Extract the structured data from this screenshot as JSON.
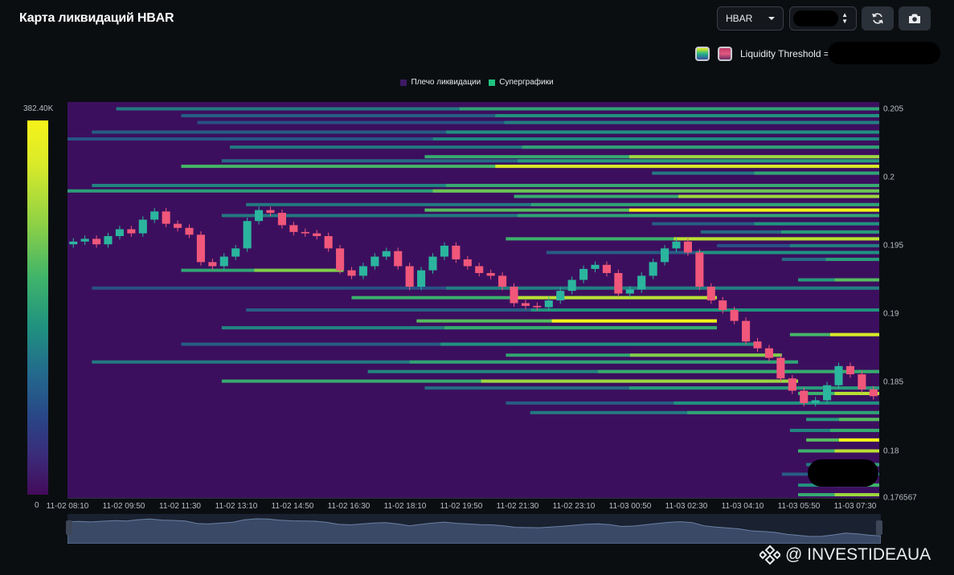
{
  "title": "Карта ликвидаций HBAR",
  "controls": {
    "symbol": "HBAR",
    "refresh_icon": "refresh-icon",
    "camera_icon": "camera-icon"
  },
  "threshold_label": "Liquidity Threshold =",
  "legend": [
    {
      "label": "Плечо ликвидации",
      "color": "#3c1a64"
    },
    {
      "label": "Суперграфики",
      "color": "#1fc27e"
    }
  ],
  "colorbar": {
    "max_label": "382.40K",
    "min_label": "0"
  },
  "watermark": "@ INVESTIDEAUA",
  "colors": {
    "background": "#0b0e11",
    "plot_bg": "#3c0f5e",
    "up": "#2bb59e",
    "down": "#f0577a"
  },
  "chart_data": {
    "type": "heatmap",
    "title": "Карта ликвидаций HBAR",
    "x_ticks": [
      "11-02 08:10",
      "11-02 09:50",
      "11-02 11:30",
      "11-02 13:10",
      "11-02 14:50",
      "11-02 16:30",
      "11-02 18:10",
      "11-02 19:50",
      "11-02 21:30",
      "11-02 23:10",
      "11-03 00:50",
      "11-03 02:30",
      "11-03 04:10",
      "11-03 05:50",
      "11-03 07:30"
    ],
    "y_ticks": [
      "0.205",
      "0.2",
      "0.195",
      "0.19",
      "0.185",
      "0.18",
      "0.176567"
    ],
    "ylim": [
      0.176567,
      0.2055
    ],
    "colorbar_range": [
      0,
      382400
    ],
    "price_series": {
      "type": "candlestick",
      "close": [
        0.1953,
        0.1955,
        0.1951,
        0.1957,
        0.1962,
        0.1959,
        0.1969,
        0.1975,
        0.1966,
        0.1963,
        0.1958,
        0.1938,
        0.1935,
        0.1942,
        0.1948,
        0.1968,
        0.1976,
        0.1974,
        0.1965,
        0.196,
        0.1959,
        0.1957,
        0.1948,
        0.1932,
        0.1928,
        0.1935,
        0.1942,
        0.1946,
        0.1935,
        0.192,
        0.1932,
        0.1942,
        0.195,
        0.194,
        0.1935,
        0.193,
        0.1928,
        0.192,
        0.1908,
        0.1906,
        0.1905,
        0.191,
        0.1917,
        0.1925,
        0.1933,
        0.1936,
        0.193,
        0.1915,
        0.1918,
        0.1928,
        0.1938,
        0.1948,
        0.1953,
        0.1945,
        0.192,
        0.191,
        0.1903,
        0.1895,
        0.188,
        0.1875,
        0.1868,
        0.1853,
        0.1844,
        0.1835,
        0.1837,
        0.1848,
        0.1862,
        0.1856,
        0.1845,
        0.184
      ]
    },
    "liquidity_levels": [
      {
        "price": 0.205,
        "start": 0.06,
        "end": 1.0,
        "intensity": 0.55
      },
      {
        "price": 0.2045,
        "start": 0.14,
        "end": 1.0,
        "intensity": 0.45
      },
      {
        "price": 0.204,
        "start": 0.16,
        "end": 1.0,
        "intensity": 0.4
      },
      {
        "price": 0.2033,
        "start": 0.03,
        "end": 1.0,
        "intensity": 0.45
      },
      {
        "price": 0.2028,
        "start": 0.0,
        "end": 1.0,
        "intensity": 0.42
      },
      {
        "price": 0.2022,
        "start": 0.2,
        "end": 1.0,
        "intensity": 0.55
      },
      {
        "price": 0.2015,
        "start": 0.44,
        "end": 1.0,
        "intensity": 0.85
      },
      {
        "price": 0.2012,
        "start": 0.19,
        "end": 1.0,
        "intensity": 0.5
      },
      {
        "price": 0.2008,
        "start": 0.14,
        "end": 1.0,
        "intensity": 0.95
      },
      {
        "price": 0.2003,
        "start": 0.72,
        "end": 1.0,
        "intensity": 0.55
      },
      {
        "price": 0.1994,
        "start": 0.03,
        "end": 1.0,
        "intensity": 0.6
      },
      {
        "price": 0.199,
        "start": 0.0,
        "end": 1.0,
        "intensity": 0.75
      },
      {
        "price": 0.1986,
        "start": 0.55,
        "end": 1.0,
        "intensity": 0.85
      },
      {
        "price": 0.198,
        "start": 0.22,
        "end": 1.0,
        "intensity": 0.55
      },
      {
        "price": 0.1976,
        "start": 0.44,
        "end": 1.0,
        "intensity": 1.0
      },
      {
        "price": 0.1972,
        "start": 0.19,
        "end": 1.0,
        "intensity": 0.55
      },
      {
        "price": 0.1966,
        "start": 0.72,
        "end": 1.0,
        "intensity": 0.45
      },
      {
        "price": 0.196,
        "start": 0.78,
        "end": 1.0,
        "intensity": 0.5
      },
      {
        "price": 0.1955,
        "start": 0.54,
        "end": 1.0,
        "intensity": 0.9
      },
      {
        "price": 0.195,
        "start": 0.8,
        "end": 1.0,
        "intensity": 0.4
      },
      {
        "price": 0.1945,
        "start": 0.59,
        "end": 1.0,
        "intensity": 0.45
      },
      {
        "price": 0.194,
        "start": 0.88,
        "end": 1.0,
        "intensity": 0.5
      },
      {
        "price": 0.1932,
        "start": 0.14,
        "end": 0.34,
        "intensity": 0.8
      },
      {
        "price": 0.1925,
        "start": 0.9,
        "end": 1.0,
        "intensity": 0.7
      },
      {
        "price": 0.1919,
        "start": 0.03,
        "end": 1.0,
        "intensity": 0.4
      },
      {
        "price": 0.1912,
        "start": 0.35,
        "end": 0.8,
        "intensity": 0.9
      },
      {
        "price": 0.1903,
        "start": 0.22,
        "end": 1.0,
        "intensity": 0.45
      },
      {
        "price": 0.1895,
        "start": 0.43,
        "end": 0.8,
        "intensity": 1.0
      },
      {
        "price": 0.189,
        "start": 0.19,
        "end": 0.8,
        "intensity": 0.6
      },
      {
        "price": 0.1885,
        "start": 0.89,
        "end": 1.0,
        "intensity": 0.95
      },
      {
        "price": 0.1878,
        "start": 0.14,
        "end": 0.85,
        "intensity": 0.45
      },
      {
        "price": 0.187,
        "start": 0.54,
        "end": 0.88,
        "intensity": 0.8
      },
      {
        "price": 0.1865,
        "start": 0.03,
        "end": 0.9,
        "intensity": 0.55
      },
      {
        "price": 0.1858,
        "start": 0.37,
        "end": 1.0,
        "intensity": 0.6
      },
      {
        "price": 0.1851,
        "start": 0.19,
        "end": 0.9,
        "intensity": 0.85
      },
      {
        "price": 0.1846,
        "start": 0.44,
        "end": 1.0,
        "intensity": 0.5
      },
      {
        "price": 0.1842,
        "start": 0.9,
        "end": 1.0,
        "intensity": 0.9
      },
      {
        "price": 0.1835,
        "start": 0.54,
        "end": 1.0,
        "intensity": 0.45
      },
      {
        "price": 0.1828,
        "start": 0.57,
        "end": 1.0,
        "intensity": 0.55
      },
      {
        "price": 0.1823,
        "start": 0.91,
        "end": 1.0,
        "intensity": 0.7
      },
      {
        "price": 0.1815,
        "start": 0.89,
        "end": 1.0,
        "intensity": 0.6
      },
      {
        "price": 0.1808,
        "start": 0.91,
        "end": 1.0,
        "intensity": 1.0
      },
      {
        "price": 0.18,
        "start": 0.9,
        "end": 1.0,
        "intensity": 0.9
      },
      {
        "price": 0.179,
        "start": 0.91,
        "end": 1.0,
        "intensity": 0.55
      },
      {
        "price": 0.1783,
        "start": 0.88,
        "end": 1.0,
        "intensity": 0.45
      },
      {
        "price": 0.1775,
        "start": 0.9,
        "end": 1.0,
        "intensity": 0.65
      },
      {
        "price": 0.1768,
        "start": 0.9,
        "end": 1.0,
        "intensity": 0.85
      }
    ]
  }
}
